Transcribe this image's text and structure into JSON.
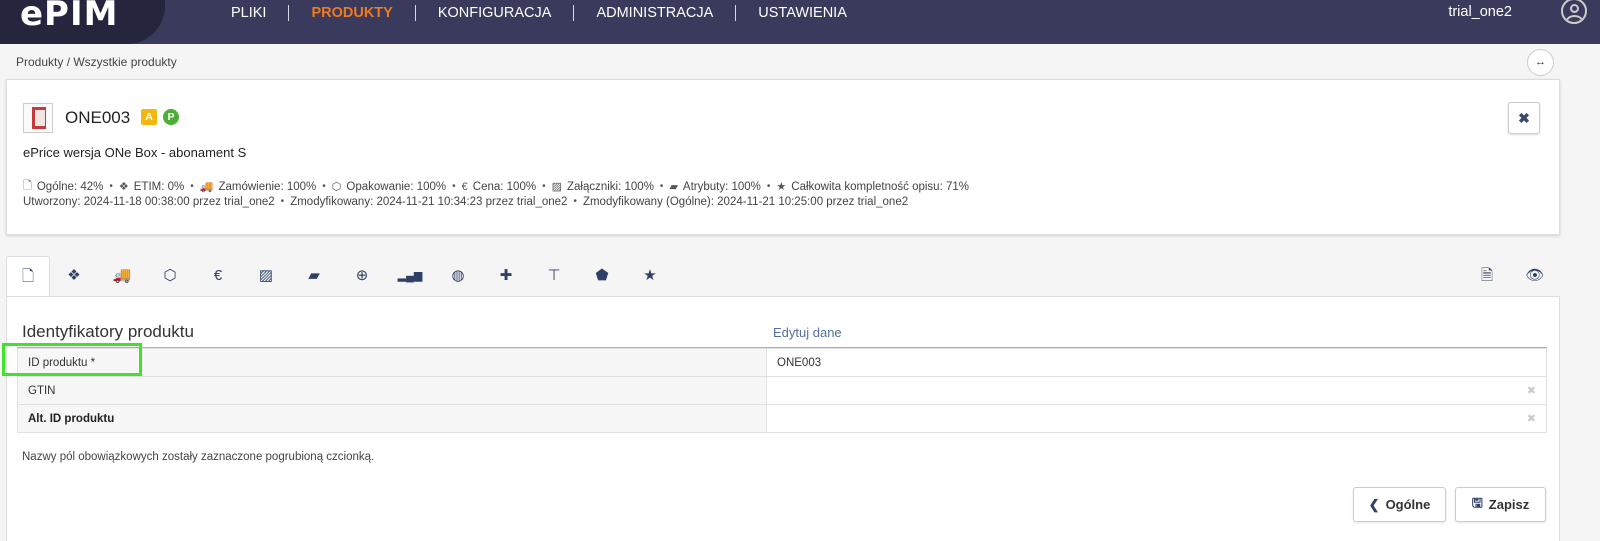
{
  "app": {
    "logo": "ePIM",
    "nav": [
      "PLIKI",
      "PRODUKTY",
      "KONFIGURACJA",
      "ADMINISTRACJA",
      "USTAWIENIA"
    ],
    "active_nav": "PRODUKTY",
    "user": "trial_one2"
  },
  "breadcrumb": "Produkty / Wszystkie produkty",
  "collapse_icon": "↔",
  "product": {
    "id": "ONE003",
    "badge_a": "A",
    "badge_p": "P",
    "name": "ePrice wersja ONe Box - abonament S",
    "stats": [
      {
        "icon": "file-icon",
        "glyph": "🗋",
        "label": "Ogólne: 42%"
      },
      {
        "icon": "etim-icon",
        "glyph": "❖",
        "label": "ETIM: 0%"
      },
      {
        "icon": "truck-icon",
        "glyph": "🚚",
        "label": "Zamówienie: 100%"
      },
      {
        "icon": "box-icon",
        "glyph": "⬡",
        "label": "Opakowanie: 100%"
      },
      {
        "icon": "euro-icon",
        "glyph": "€",
        "label": "Cena: 100%"
      },
      {
        "icon": "image-icon",
        "glyph": "▨",
        "label": "Załączniki: 100%"
      },
      {
        "icon": "note-icon",
        "glyph": "▰",
        "label": "Atrybuty: 100%"
      },
      {
        "icon": "star-icon",
        "glyph": "★",
        "label": "Całkowita kompletność opisu: 71%"
      }
    ],
    "created": [
      "Utworzony: 2024-11-18 00:38:00 przez trial_one2",
      "Zmodyfikowany: 2024-11-21 10:34:23 przez trial_one2",
      "Zmodyfikowany (Ogólne): 2024-11-21 10:25:00 przez trial_one2"
    ]
  },
  "tabs": [
    {
      "name": "tab-general",
      "glyph": "🗋"
    },
    {
      "name": "tab-etim",
      "glyph": "❖"
    },
    {
      "name": "tab-order",
      "glyph": "🚚"
    },
    {
      "name": "tab-packaging",
      "glyph": "⬡"
    },
    {
      "name": "tab-price",
      "glyph": "€"
    },
    {
      "name": "tab-attachments",
      "glyph": "▨"
    },
    {
      "name": "tab-attributes",
      "glyph": "▰"
    },
    {
      "name": "tab-add",
      "glyph": "⊕"
    },
    {
      "name": "tab-signal",
      "glyph": "▂▄▆"
    },
    {
      "name": "tab-globe",
      "glyph": "◍"
    },
    {
      "name": "tab-puzzle",
      "glyph": "✚"
    },
    {
      "name": "tab-hierarchy",
      "glyph": "⊤"
    },
    {
      "name": "tab-tag",
      "glyph": "⬟"
    },
    {
      "name": "tab-star",
      "glyph": "★"
    }
  ],
  "section": {
    "title": "Identyfikatory produktu",
    "edit_label": "Edytuj dane",
    "rows": [
      {
        "label": "ID produktu *",
        "value": "ONE003",
        "bold": false,
        "clear": false
      },
      {
        "label": "GTIN",
        "value": "",
        "bold": false,
        "clear": true
      },
      {
        "label": "Alt. ID produktu",
        "value": "",
        "bold": true,
        "clear": true
      }
    ],
    "note": "Nazwy pól obowiązkowych zostały zaznaczone pogrubioną czcionką."
  },
  "buttons": {
    "prev": "Ogólne",
    "save": "Zapisz"
  },
  "colors": {
    "topbar": "#3a3a5c",
    "active_nav": "#f07a1e",
    "highlight": "#3fe32a"
  }
}
